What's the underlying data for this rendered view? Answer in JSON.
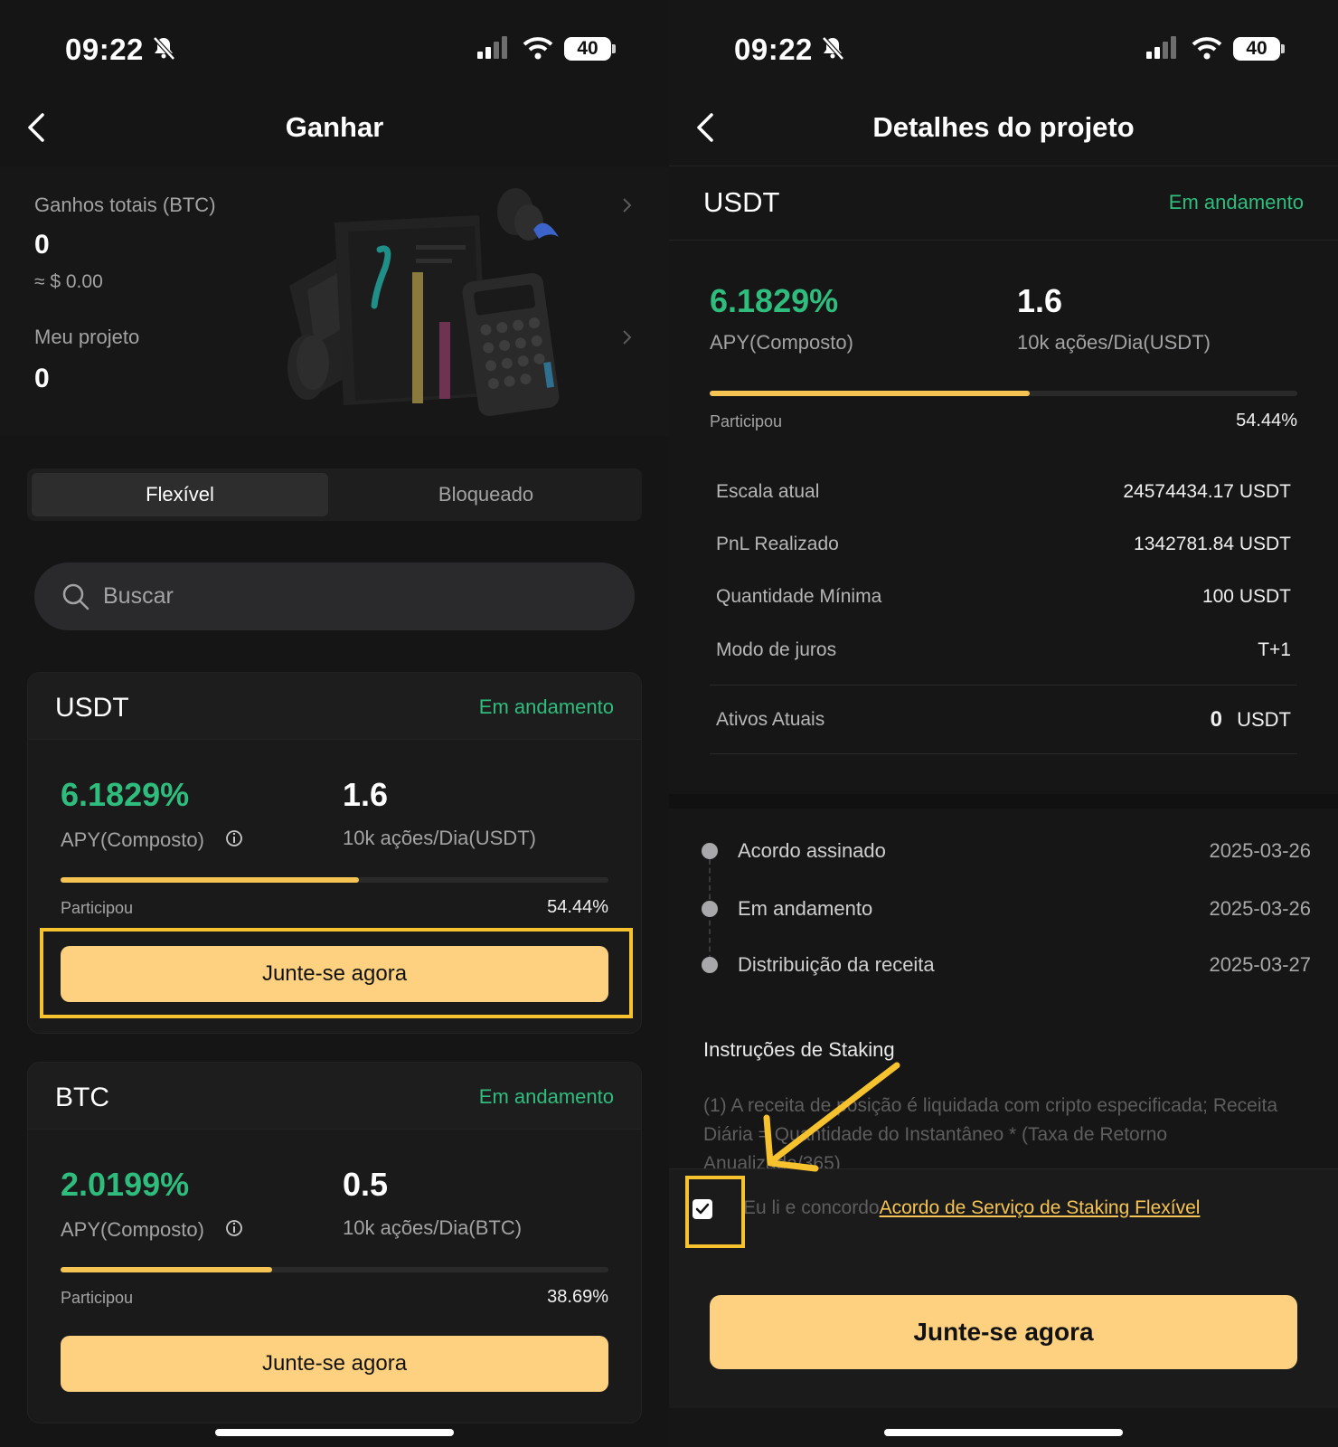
{
  "status_bar": {
    "time": "09:22",
    "battery": "40"
  },
  "left": {
    "nav_title": "Ganhar",
    "summary": {
      "total_label": "Ganhos totais (BTC)",
      "total_value": "0",
      "total_usd": "≈ $ 0.00",
      "project_label": "Meu projeto",
      "project_value": "0"
    },
    "tabs": [
      {
        "label": "Flexível",
        "active": true
      },
      {
        "label": "Bloqueado",
        "active": false
      }
    ],
    "search": {
      "placeholder": "Buscar"
    },
    "products": [
      {
        "coin": "USDT",
        "status": "Em andamento",
        "apy": "6.1829%",
        "apy_label": "APY(Composto)",
        "reward": "1.6",
        "reward_label": "10k ações/Dia(USDT)",
        "participated_label": "Participou",
        "participated_value": "54.44%",
        "participated_fraction": 0.5444,
        "button": "Junte-se agora"
      },
      {
        "coin": "BTC",
        "status": "Em andamento",
        "apy": "2.0199%",
        "apy_label": "APY(Composto)",
        "reward": "0.5",
        "reward_label": "10k ações/Dia(BTC)",
        "participated_label": "Participou",
        "participated_value": "38.69%",
        "participated_fraction": 0.3869,
        "button": "Junte-se agora"
      }
    ]
  },
  "right": {
    "nav_title": "Detalhes do projeto",
    "coin": "USDT",
    "status": "Em andamento",
    "apy": "6.1829%",
    "apy_label": "APY(Composto)",
    "reward": "1.6",
    "reward_label": "10k ações/Dia(USDT)",
    "participated_label": "Participou",
    "participated_value": "54.44%",
    "participated_fraction": 0.5444,
    "details": [
      {
        "label": "Escala atual",
        "value": "24574434.17 USDT"
      },
      {
        "label": "PnL Realizado",
        "value": "1342781.84 USDT"
      },
      {
        "label": "Quantidade Mínima",
        "value": "100 USDT"
      },
      {
        "label": "Modo de juros",
        "value": "T+1"
      }
    ],
    "assets": {
      "label": "Ativos Atuais",
      "amount": "0",
      "unit": "USDT"
    },
    "timeline": [
      {
        "label": "Acordo assinado",
        "date": "2025-03-26"
      },
      {
        "label": "Em andamento",
        "date": "2025-03-26"
      },
      {
        "label": "Distribuição da receita",
        "date": "2025-03-27"
      }
    ],
    "instructions_title": "Instruções de Staking",
    "instructions_text": "(1) A receita de posição é liquidada com cripto especificada; Receita Diária = Quantidade do Instantâneo * (Taxa de Retorno Anualizada/365)",
    "agreement_prefix": "Eu li e concordo",
    "agreement_link": "Acordo de Serviço de Staking Flexível",
    "agreement_checked": true,
    "button": "Junte-se agora"
  },
  "colors": {
    "accent": "#fdd17f",
    "progress": "#f6c453",
    "status_green": "#2fbd7e",
    "highlight": "#f6c22e"
  }
}
